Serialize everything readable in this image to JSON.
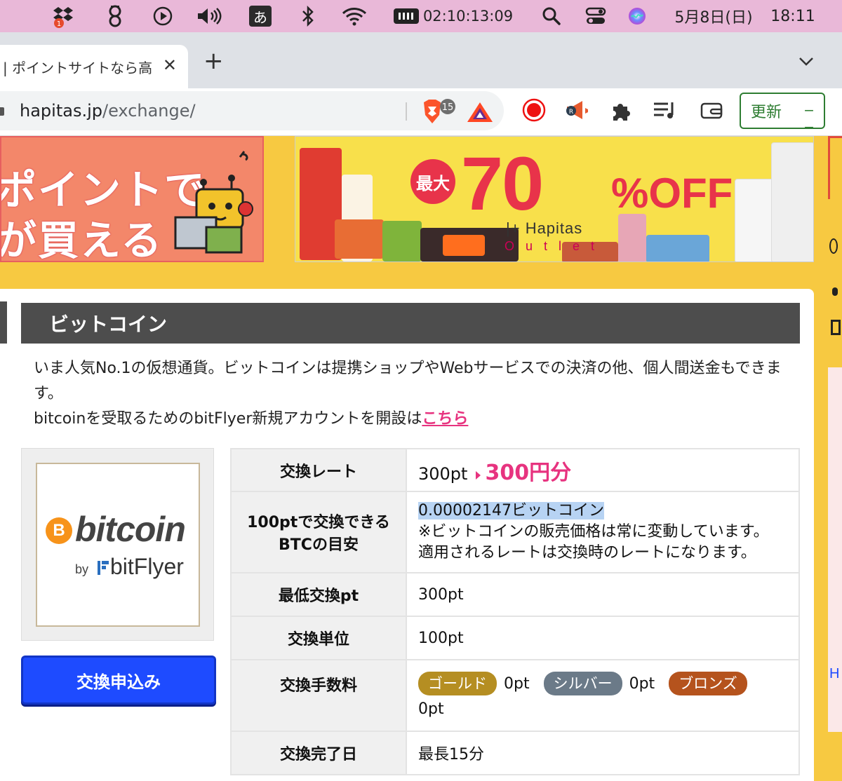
{
  "menubar": {
    "ime_label": "あ",
    "dropbox_badge": "1",
    "timer": "02:10:13:09",
    "date": "5月8日(日)",
    "time": "18:11"
  },
  "browser": {
    "tab_title": "| ポイントサイトなら高",
    "url_host": "hapitas.jp",
    "url_path": "/exchange/",
    "brave_badge": "15",
    "update_label": "更新"
  },
  "banners": {
    "left_lines": [
      "ポイントで",
      "が買える"
    ],
    "sale_prefix": "最大",
    "sale_number": "70",
    "sale_suffix": "%OFF",
    "outlet_brand": "Hapitas",
    "outlet_sub": "Outlet"
  },
  "exchange": {
    "title": "ビットコイン",
    "description": "いま人気No.1の仮想通貨。ビットコインは提携ショップやWebサービスでの決済の他、個人間送金もできます。",
    "signup_text": "bitcoinを受取るためのbitFlyer新規アカウントを開設は",
    "signup_link": "こちら",
    "logo_brand": "bitcoin",
    "logo_coin": "B",
    "logo_by": "by",
    "logo_partner": "bitFlyer",
    "apply_button": "交換申込み",
    "rows": {
      "rate": {
        "label": "交換レート",
        "from": "300pt",
        "to": "300円分"
      },
      "btc": {
        "label_line1": "100ptで交換できる",
        "label_line2": "BTCの目安",
        "value": "0.00002147ビットコイン",
        "note1": "※ビットコインの販売価格は常に変動しています。",
        "note2": "適用されるレートは交換時のレートになります。"
      },
      "min": {
        "label": "最低交換pt",
        "value": "300pt"
      },
      "unit": {
        "label": "交換単位",
        "value": "100pt"
      },
      "fee": {
        "label": "交換手数料",
        "gold": "ゴールド",
        "gold_val": "0pt",
        "silver": "シルバー",
        "silver_val": "0pt",
        "bronze": "ブロンズ",
        "bronze_val": "0pt"
      },
      "completion": {
        "label": "交換完了日",
        "value": "最長15分"
      }
    }
  },
  "colors": {
    "page_bg": "#f7c941",
    "accent_pink": "#e7337f",
    "apply_blue": "#1e4bff",
    "header_dark": "#4d4d4d"
  }
}
